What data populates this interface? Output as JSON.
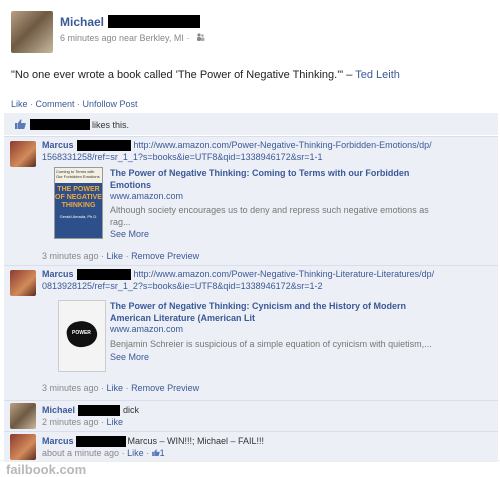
{
  "post": {
    "author_first": "Michael",
    "meta": "6 minutes ago near Berkley, MI ·",
    "status_quote": "\"No one ever wrote a book called 'The Power of Negative Thinking.'\"",
    "status_dash": " – ",
    "status_author": "Ted Leith"
  },
  "actions": {
    "like": "Like",
    "comment": "Comment",
    "unfollow": "Unfollow Post",
    "sep": " · "
  },
  "likes": {
    "text": "likes this."
  },
  "comments": [
    {
      "author": "Marcus",
      "url": "http://www.amazon.com/Power-Negative-Thinking-Forbidden-Emotions/dp/1568331258/ref=sr_1_1?s=books&ie=UTF8&qid=1338946172&sr=1-1",
      "url_line1": "http://www.amazon.com/Power-Negative-Thinking-Forbidden-Emotions/dp/",
      "url_line2": "1568331258/ref=sr_1_1?s=books&ie=UTF8&qid=1338946172&sr=1-1",
      "preview_title": "The Power of Negative Thinking: Coming to Terms with our Forbidden Emotions",
      "preview_title_1": "The Power of Negative Thinking: Coming to Terms with our Forbidden",
      "preview_title_2": "Emotions",
      "preview_site": "www.amazon.com",
      "preview_desc_1": "Although society encourages us to deny and repress such negative emotions as",
      "preview_desc_2": "rag...",
      "see_more": "See More",
      "time": "3 minutes ago",
      "like": "Like",
      "remove": "Remove Preview"
    },
    {
      "author": "Marcus",
      "url_line1": "http://www.amazon.com/Power-Negative-Thinking-Literature-Literatures/dp/",
      "url_line2": "0813928125/ref=sr_1_2?s=books&ie=UTF8&qid=1338946172&sr=1-2",
      "preview_title_1": "The Power of Negative Thinking: Cynicism and the History of Modern",
      "preview_title_2": "American Literature (American Lit",
      "preview_site": "www.amazon.com",
      "preview_desc_1": "Benjamin Schreier is suspicious of a simple equation of cynicism with quietism,...",
      "see_more": "See More",
      "time": "3 minutes ago",
      "like": "Like",
      "remove": "Remove Preview"
    },
    {
      "author": "Michael",
      "text": "dick",
      "time": "2 minutes ago",
      "like": "Like"
    },
    {
      "author": "Marcus",
      "text": "Marcus – WIN!!!; Michael – FAIL!!!",
      "time": "about a minute ago",
      "like": "Like",
      "like_count": "1"
    }
  ],
  "book1_cover": {
    "top_text": "Coming to Terms with Our Forbidden Emotions",
    "title_1": "THE POWER",
    "title_2": "OF NEGATIVE",
    "title_3": "THINKING",
    "author": "Gerald Amada, Ph.D."
  },
  "book2_cover": {
    "title": "POWER"
  },
  "footer": {
    "text": "failbook.com"
  },
  "colors": {
    "link": "#3b5998",
    "comment_bg": "#eceff5",
    "footer": "#b8b8b8"
  }
}
